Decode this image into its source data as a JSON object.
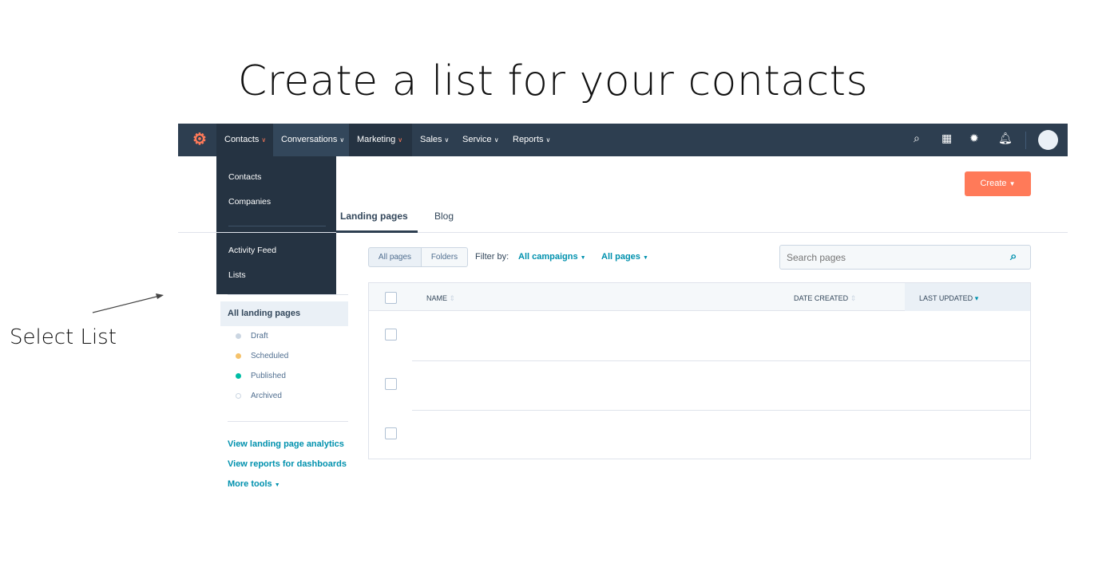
{
  "slide": {
    "title": "Create a list for your contacts",
    "annotation": "Select List"
  },
  "nav": {
    "items": [
      {
        "label": "Contacts"
      },
      {
        "label": "Conversations"
      },
      {
        "label": "Marketing"
      },
      {
        "label": "Sales"
      },
      {
        "label": "Service"
      },
      {
        "label": "Reports"
      }
    ],
    "icons": [
      "search-icon",
      "marketplace-icon",
      "gear-icon",
      "bell-icon",
      "avatar"
    ]
  },
  "dropdown": {
    "items": [
      "Contacts",
      "Companies",
      "Activity Feed",
      "Lists"
    ]
  },
  "create_label": "Create",
  "tabs": [
    "Landing pages",
    "Blog"
  ],
  "toolbar": {
    "all_pages": "All pages",
    "folders": "Folders",
    "filter_by": "Filter by:",
    "campaigns": "All campaigns",
    "pages": "All pages",
    "search_placeholder": "Search pages"
  },
  "sidebar": {
    "header": "All landing pages",
    "statuses": [
      {
        "label": "Draft",
        "color": "#cbd6e2"
      },
      {
        "label": "Scheduled",
        "color": "#f5c26b"
      },
      {
        "label": "Published",
        "color": "#00bda5"
      },
      {
        "label": "Archived",
        "color": "#ffffff"
      }
    ],
    "links": [
      "View landing page analytics",
      "View reports for dashboards",
      "More tools"
    ]
  },
  "table": {
    "columns": [
      "NAME",
      "DATE CREATED",
      "LAST UPDATED"
    ]
  }
}
